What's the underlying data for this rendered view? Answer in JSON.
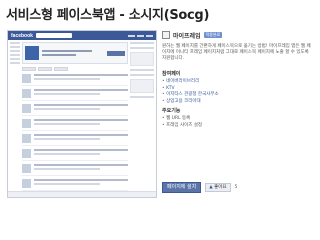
{
  "slide": {
    "title": "서비스형 페이스북앱 - 소시지(Socg)"
  },
  "facebook_preview": {
    "logo": "facebook"
  },
  "app_panel": {
    "app_name": "마이프레임",
    "badge": "적용완료",
    "description": "원하는 웹 페이지를 간편하게 페이스북으로 옮기는 방법! 마이프레임 앱은 웹 페이지에 이니티 프레임 페이지처럼 그대로 페이스북 페이지에 노출 할 수 있도록 지원합니다.",
    "examples_title": "참여페이",
    "examples": [
      "네이버라이브러리",
      "KTV",
      "이지타스 관광청 한국사무소",
      "상업고용 코리아대"
    ],
    "features_title": "주요기능",
    "features": [
      "웹 URL 등록",
      "프레임 사이즈 설정"
    ],
    "install_button": "페이지에 설치",
    "like_button": "좋아요",
    "like_count": "5"
  }
}
